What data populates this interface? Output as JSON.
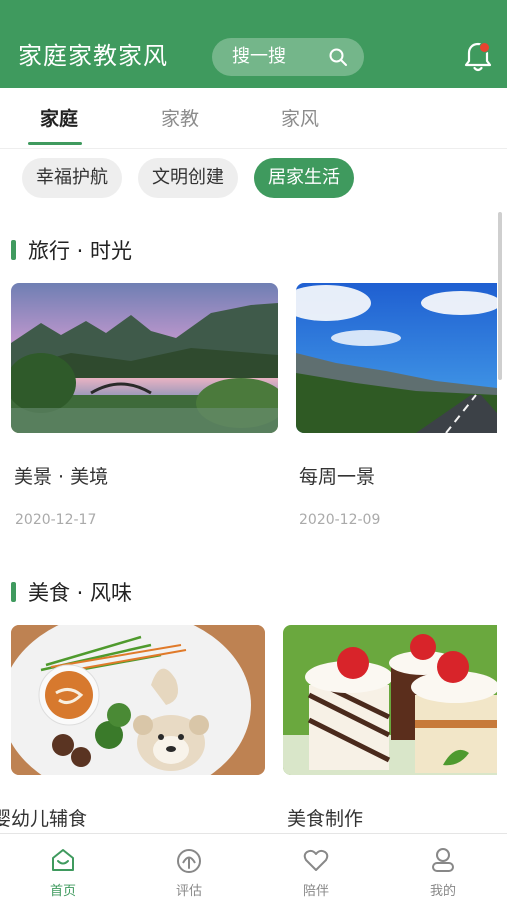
{
  "header": {
    "title": "家庭家教家风",
    "search_label": "搜一搜",
    "accent_color": "#3f9a5e",
    "notification_dot_color": "#e8432f"
  },
  "tabs": [
    {
      "label": "家庭",
      "active": true
    },
    {
      "label": "家教",
      "active": false
    },
    {
      "label": "家风",
      "active": false
    }
  ],
  "chips": [
    {
      "label": "幸福护航",
      "active": false
    },
    {
      "label": "文明创建",
      "active": false
    },
    {
      "label": "居家生活",
      "active": true
    }
  ],
  "sections": [
    {
      "title": "旅行 · 时光",
      "cards": [
        {
          "title": "美景 · 美境",
          "date": "2020-12-17",
          "image": "lake-mountain-sunset"
        },
        {
          "title": "每周一景",
          "date": "2020-12-09",
          "image": "mountain-road-blue-sky"
        }
      ]
    },
    {
      "title": "美食 · 风味",
      "cards": [
        {
          "title": "婴幼儿辅食",
          "date": "",
          "image": "bear-shaped-baby-food-plate"
        },
        {
          "title": "美食制作",
          "date": "",
          "image": "strawberry-cream-cakes"
        }
      ]
    }
  ],
  "bottom_nav": [
    {
      "label": "首页",
      "icon": "home-icon",
      "active": true
    },
    {
      "label": "评估",
      "icon": "gauge-icon",
      "active": false
    },
    {
      "label": "陪伴",
      "icon": "heart-icon",
      "active": false
    },
    {
      "label": "我的",
      "icon": "user-icon",
      "active": false
    }
  ]
}
